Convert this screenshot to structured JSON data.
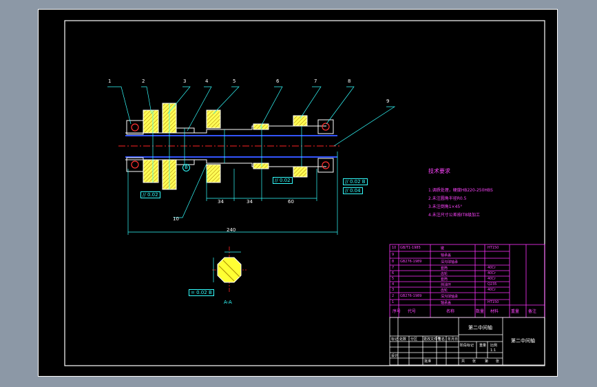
{
  "drawing": {
    "callouts": [
      "1",
      "2",
      "3",
      "4",
      "5",
      "6",
      "7",
      "8",
      "9",
      "10"
    ],
    "dimensions": {
      "d1": "34",
      "d2": "34",
      "d3": "60",
      "total": "240"
    },
    "tolerances": {
      "t1_sym": "//",
      "t1_val": "0.02",
      "t2_sym": "//",
      "t2_val": "0.02",
      "t3_sym": "//",
      "t3_val": "0.02",
      "t3_ref": "B",
      "t4_sym": "//",
      "t4_val": "0.04",
      "t5_sym": "=",
      "t5_val": "0.02",
      "t5_ref": "B"
    },
    "datum": "B",
    "section_label": "A-A",
    "notes_title": "技术要求",
    "notes": [
      "1.调质处理，硬度HB220-250HBS",
      "2.未注圆角半径R0.5",
      "3.未注倒角1×45°",
      "4.未注尺寸公差按IT8级加工"
    ]
  },
  "bom": {
    "top_ref": "GB/T1-1985",
    "rows": [
      {
        "no": "10",
        "std": "GB/T1-1985",
        "name": "键",
        "qty": "",
        "mat": "HT150"
      },
      {
        "no": "9",
        "std": "",
        "name": "轴承盖",
        "qty": "",
        "mat": ""
      },
      {
        "no": "8",
        "std": "GB276-1989",
        "name": "深沟球轴承",
        "qty": "",
        "mat": ""
      },
      {
        "no": "7",
        "std": "",
        "name": "套筒",
        "qty": "",
        "mat": "40Cr"
      },
      {
        "no": "6",
        "std": "",
        "name": "齿轮",
        "qty": "",
        "mat": "40Cr"
      },
      {
        "no": "5",
        "std": "",
        "name": "套筒",
        "qty": "",
        "mat": "40Cr"
      },
      {
        "no": "4",
        "std": "",
        "name": "挡油环",
        "qty": "",
        "mat": "Q235"
      },
      {
        "no": "3",
        "std": "",
        "name": "齿轮",
        "qty": "",
        "mat": "40Cr"
      },
      {
        "no": "2",
        "std": "GB276-1989",
        "name": "深沟球轴承",
        "qty": "",
        "mat": ""
      },
      {
        "no": "1",
        "std": "",
        "name": "轴承盖",
        "qty": "",
        "mat": "HT150"
      }
    ],
    "header": {
      "no": "序号",
      "std": "代号",
      "name": "名称",
      "qty": "数量",
      "mat": "材料",
      "wt": "重量",
      "note": "备注"
    }
  },
  "title_block": {
    "name1": "第二中间轴",
    "name2": "第二中间轴",
    "row_labels": [
      "标记",
      "处数",
      "分区",
      "更改文件号",
      "签名",
      "年月日"
    ],
    "design": "设计",
    "stage": "阶段标记",
    "weight": "重量",
    "scale": "比例",
    "sheet1": "共",
    "sheet2": "张",
    "sheet3": "第",
    "sheet4": "张",
    "scale_val": "1:1",
    "approve": "批准"
  }
}
